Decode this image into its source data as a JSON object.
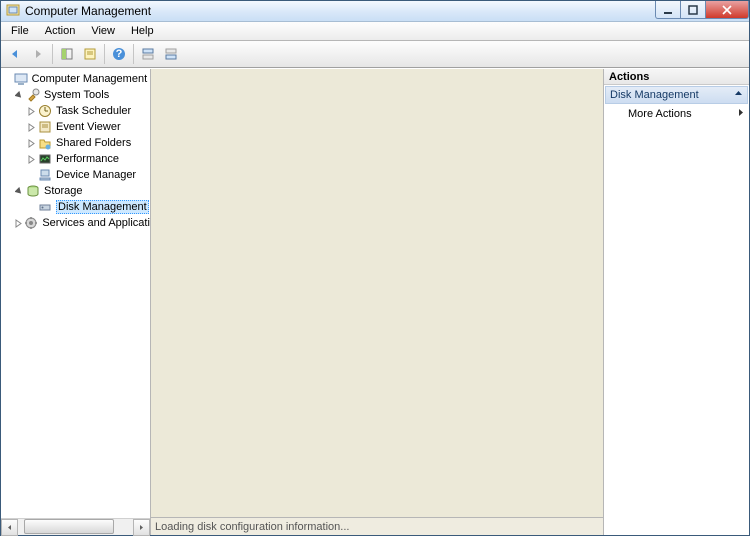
{
  "title": "Computer Management",
  "menu": {
    "file": "File",
    "action": "Action",
    "view": "View",
    "help": "Help"
  },
  "tree": {
    "root": "Computer Management (Local",
    "systools": "System Tools",
    "scheduler": "Task Scheduler",
    "eventviewer": "Event Viewer",
    "shared": "Shared Folders",
    "perf": "Performance",
    "devmgr": "Device Manager",
    "storage": "Storage",
    "diskmgmt": "Disk Management",
    "services": "Services and Applications"
  },
  "center": {
    "status": "Loading disk configuration information..."
  },
  "actions": {
    "header": "Actions",
    "group": "Disk Management",
    "more": "More Actions"
  }
}
